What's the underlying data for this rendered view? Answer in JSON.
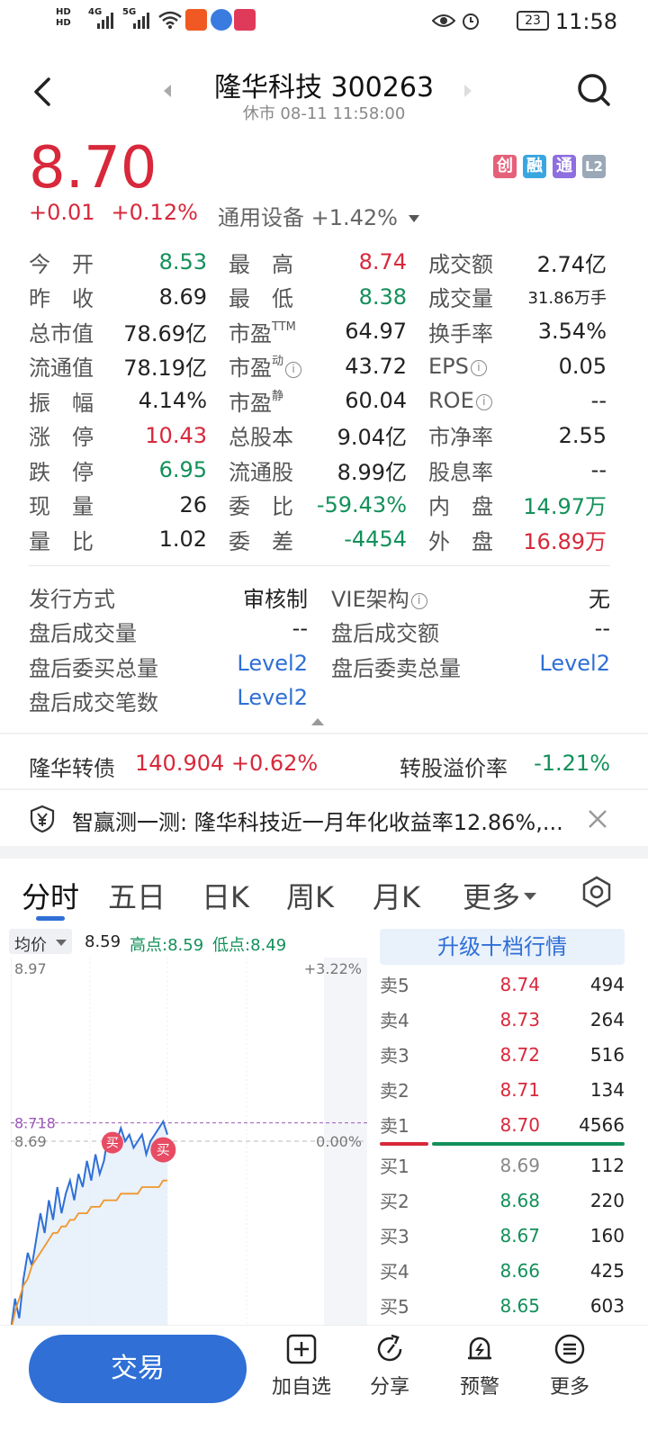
{
  "status_bar": {
    "time": "11:58",
    "battery": "23",
    "hd1": "HD",
    "hd2": "HD",
    "net1": "4G",
    "net2": "5G"
  },
  "header": {
    "title": "隆华科技 300263",
    "subtitle": "休市 08-11 11:58:00"
  },
  "price": {
    "current": "8.70",
    "change": "+0.01",
    "change_pct": "+0.12%",
    "sector": "通用设备 +1.42%"
  },
  "tags": [
    "创",
    "融",
    "通",
    "L2"
  ],
  "quote_rows": [
    [
      {
        "l": "今　开",
        "v": "8.53",
        "c": "green"
      },
      {
        "l": "最　高",
        "v": "8.74",
        "c": "red"
      },
      {
        "l": "成交额",
        "v": "2.74亿",
        "c": ""
      }
    ],
    [
      {
        "l": "昨　收",
        "v": "8.69",
        "c": ""
      },
      {
        "l": "最　低",
        "v": "8.38",
        "c": "green"
      },
      {
        "l": "成交量",
        "v": "31.86万手",
        "c": "small"
      }
    ],
    [
      {
        "l": "总市值",
        "v": "78.69亿",
        "c": ""
      },
      {
        "l": "市盈",
        "sup": "TTM",
        "v": "64.97",
        "c": ""
      },
      {
        "l": "换手率",
        "v": "3.54%",
        "c": ""
      }
    ],
    [
      {
        "l": "流通值",
        "v": "78.19亿",
        "c": ""
      },
      {
        "l": "市盈",
        "sup": "动",
        "info": true,
        "v": "43.72",
        "c": ""
      },
      {
        "l": "EPS",
        "info": true,
        "v": "0.05",
        "c": ""
      }
    ],
    [
      {
        "l": "振　幅",
        "v": "4.14%",
        "c": ""
      },
      {
        "l": "市盈",
        "sup": "静",
        "v": "60.04",
        "c": ""
      },
      {
        "l": "ROE",
        "info": true,
        "v": "--",
        "c": ""
      }
    ],
    [
      {
        "l": "涨　停",
        "v": "10.43",
        "c": "red"
      },
      {
        "l": "总股本",
        "v": "9.04亿",
        "c": ""
      },
      {
        "l": "市净率",
        "v": "2.55",
        "c": ""
      }
    ],
    [
      {
        "l": "跌　停",
        "v": "6.95",
        "c": "green"
      },
      {
        "l": "流通股",
        "v": "8.99亿",
        "c": ""
      },
      {
        "l": "股息率",
        "v": "--",
        "c": ""
      }
    ],
    [
      {
        "l": "现　量",
        "v": "26",
        "c": ""
      },
      {
        "l": "委　比",
        "v": "-59.43%",
        "c": "green"
      },
      {
        "l": "内　盘",
        "v": "14.97万",
        "c": "green"
      }
    ],
    [
      {
        "l": "量　比",
        "v": "1.02",
        "c": ""
      },
      {
        "l": "委　差",
        "v": "-4454",
        "c": "green"
      },
      {
        "l": "外　盘",
        "v": "16.89万",
        "c": "red"
      }
    ]
  ],
  "ext_rows": [
    [
      {
        "l": "发行方式",
        "v": "审核制",
        "c": ""
      },
      {
        "l": "VIE架构",
        "info": true,
        "v": "无",
        "c": ""
      }
    ],
    [
      {
        "l": "盘后成交量",
        "v": "--",
        "c": ""
      },
      {
        "l": "盘后成交额",
        "v": "--",
        "c": ""
      }
    ],
    [
      {
        "l": "盘后委买总量",
        "v": "Level2",
        "c": "blue"
      },
      {
        "l": "盘后委卖总量",
        "v": "Level2",
        "c": "blue"
      }
    ],
    [
      {
        "l": "盘后成交笔数",
        "v": "Level2",
        "c": "blue"
      }
    ]
  ],
  "bond": {
    "name": "隆华转债",
    "value": "140.904 +0.62%",
    "premium_label": "转股溢价率",
    "premium": "-1.21%"
  },
  "notice": {
    "text": "智赢测一测: 隆华科技近一月年化收益率12.86%,..."
  },
  "tabs": [
    "分时",
    "五日",
    "日K",
    "周K",
    "月K",
    "更多"
  ],
  "chart_head": {
    "avg_label": "均价",
    "avg_value": "8.59",
    "high": "高点:8.59",
    "low": "低点:8.49"
  },
  "chart_data": {
    "type": "line",
    "y_top_label": "8.97",
    "y_top_pct": "+3.22%",
    "prev_close_label": "8.69",
    "zero_pct": "0.00%",
    "high_marker": "8.718",
    "buy_marker": "买",
    "price_series": [
      8.4,
      8.45,
      8.42,
      8.48,
      8.52,
      8.5,
      8.54,
      8.58,
      8.55,
      8.6,
      8.57,
      8.62,
      8.58,
      8.61,
      8.63,
      8.6,
      8.64,
      8.62,
      8.66,
      8.63,
      8.67,
      8.64,
      8.66,
      8.7,
      8.68,
      8.69,
      8.71,
      8.69,
      8.7,
      8.68,
      8.69,
      8.7,
      8.67,
      8.69,
      8.7,
      8.71,
      8.72,
      8.7
    ],
    "avg_series": [
      8.4,
      8.43,
      8.45,
      8.47,
      8.48,
      8.5,
      8.51,
      8.52,
      8.53,
      8.54,
      8.55,
      8.55,
      8.56,
      8.56,
      8.57,
      8.57,
      8.58,
      8.58,
      8.58,
      8.59,
      8.59,
      8.59,
      8.6,
      8.6,
      8.6,
      8.6,
      8.61,
      8.61,
      8.61,
      8.61,
      8.61,
      8.62,
      8.62,
      8.62,
      8.62,
      8.62,
      8.63,
      8.63
    ],
    "ylim": [
      8.41,
      8.97
    ]
  },
  "order_book": {
    "upgrade": "升级十档行情",
    "sells": [
      {
        "label": "卖5",
        "price": "8.74",
        "vol": "494"
      },
      {
        "label": "卖4",
        "price": "8.73",
        "vol": "264"
      },
      {
        "label": "卖3",
        "price": "8.72",
        "vol": "516"
      },
      {
        "label": "卖2",
        "price": "8.71",
        "vol": "134"
      },
      {
        "label": "卖1",
        "price": "8.70",
        "vol": "4566"
      }
    ],
    "buys": [
      {
        "label": "买1",
        "price": "8.69",
        "vol": "112",
        "c": "gray"
      },
      {
        "label": "买2",
        "price": "8.68",
        "vol": "220",
        "c": "green"
      },
      {
        "label": "买3",
        "price": "8.67",
        "vol": "160",
        "c": "green"
      },
      {
        "label": "买4",
        "price": "8.66",
        "vol": "425",
        "c": "green"
      },
      {
        "label": "买5",
        "price": "8.65",
        "vol": "603",
        "c": "green"
      }
    ]
  },
  "bottom_bar": {
    "trade": "交易",
    "add": "加自选",
    "share": "分享",
    "alert": "预警",
    "more": "更多"
  }
}
